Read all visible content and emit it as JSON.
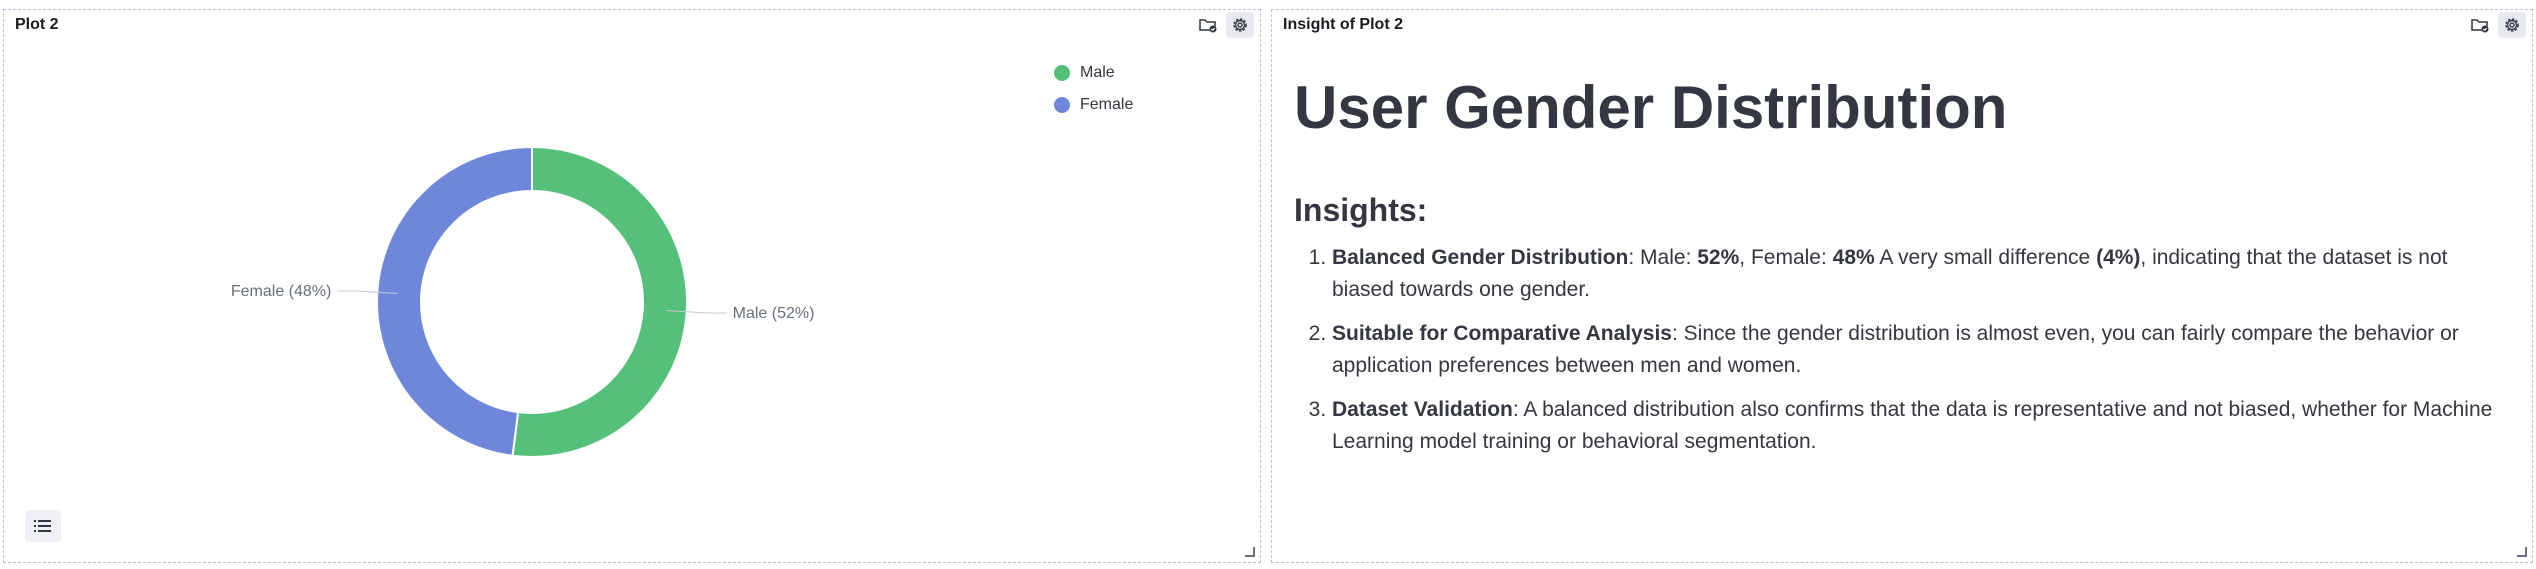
{
  "left_panel": {
    "title": "Plot 2",
    "icons": [
      "folder-check-icon",
      "gear-icon"
    ],
    "legend": [
      {
        "label": "Male",
        "color": "#54c07a"
      },
      {
        "label": "Female",
        "color": "#6e87db"
      }
    ],
    "list_icon": "list-icon"
  },
  "chart_data": {
    "type": "pie",
    "donut": true,
    "categories": [
      "Male",
      "Female"
    ],
    "values": [
      52,
      48
    ],
    "colors": [
      "#54c07a",
      "#6e87db"
    ],
    "slice_labels": [
      "Male (52%)",
      "Female (48%)"
    ],
    "legend_position": "top-right"
  },
  "right_panel": {
    "title": "Insight of Plot 2",
    "icons": [
      "folder-check-icon",
      "gear-icon"
    ],
    "heading": "User Gender Distribution",
    "subheading": "Insights:",
    "items": [
      {
        "lead": "Balanced Gender Distribution",
        "t1": ": Male: ",
        "b1": "52%",
        "t2": ", Female: ",
        "b2": "48%",
        "t3": " A very small difference ",
        "b3": "(4%)",
        "t4": ", indicating that the dataset is not biased towards one gender."
      },
      {
        "lead": "Suitable for Comparative Analysis",
        "text": ": Since the gender distribution is almost even, you can fairly compare the behavior or application preferences between men and women."
      },
      {
        "lead": "Dataset Validation",
        "text": ": A balanced distribution also confirms that the data is representative and not biased, whether for Machine Learning model training or behavioral segmentation."
      }
    ]
  }
}
